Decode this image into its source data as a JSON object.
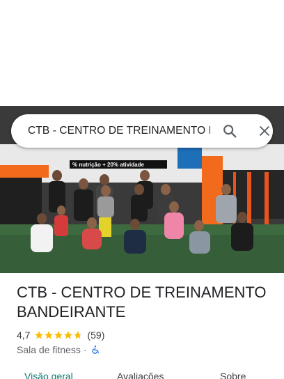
{
  "search": {
    "query": "CTB - CENTRO DE TREINAMENTO B"
  },
  "photo": {
    "banner_text": "% nutrição + 20% atividade"
  },
  "place": {
    "title": "CTB - CENTRO DE TREINAMENTO BANDEIRANTE",
    "rating": "4,7",
    "stars": 4.7,
    "reviews": "(59)",
    "category": "Sala de fitness",
    "separator": "·"
  },
  "tabs": [
    {
      "label": "Visão geral",
      "active": true
    },
    {
      "label": "Avaliações",
      "active": false
    },
    {
      "label": "Sobre",
      "active": false
    }
  ],
  "colors": {
    "accent": "#0b7a6e",
    "star": "#fbbc04",
    "gym_orange": "#f26b1d",
    "wheelchair": "#1a73e8"
  }
}
